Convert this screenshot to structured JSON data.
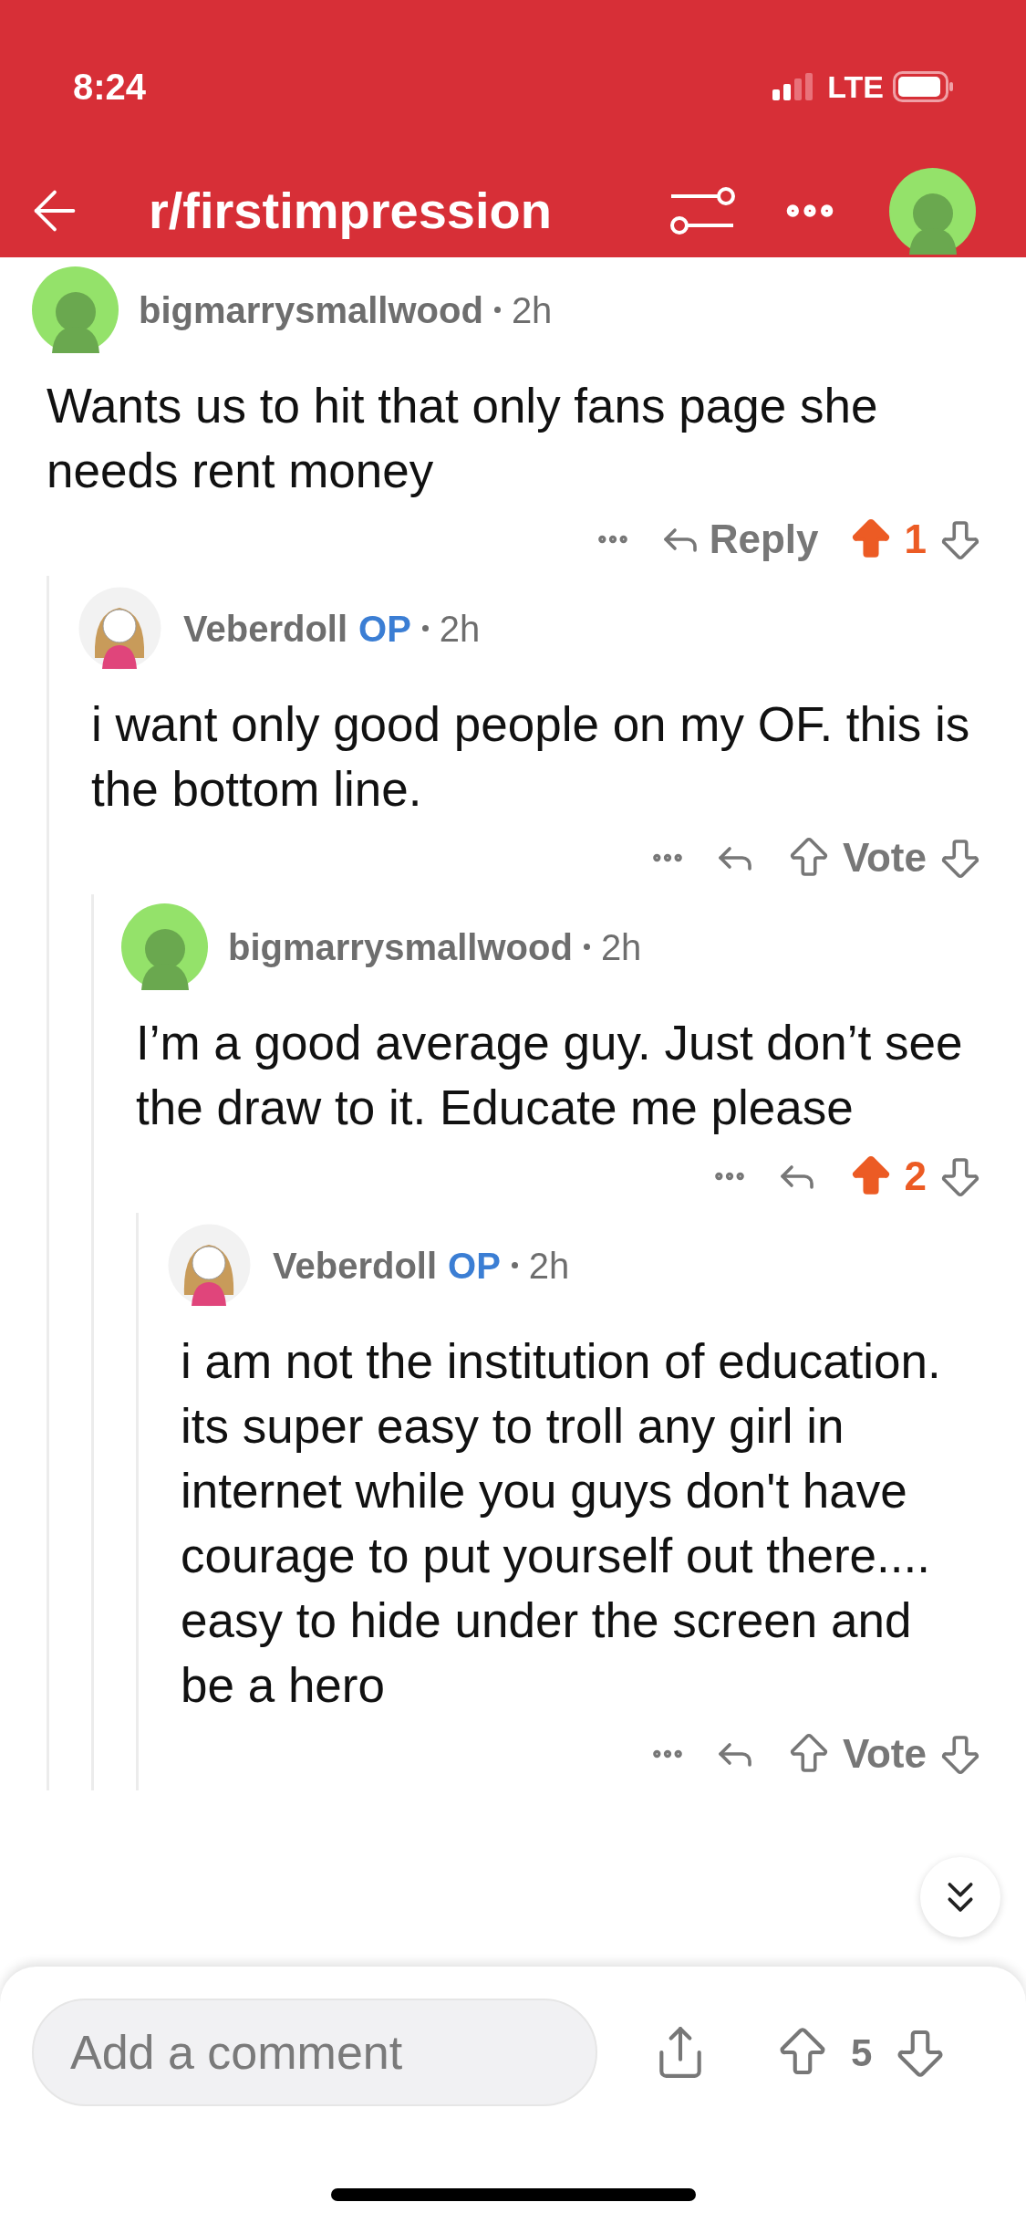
{
  "status_bar": {
    "time": "8:24",
    "network": "LTE"
  },
  "header": {
    "title": "r/firstimpression"
  },
  "comments": [
    {
      "author": "bigmarrysmallwood",
      "avatar": {
        "kind": "default"
      },
      "time": "2h",
      "body": "Wants us to hit that only fans page she needs rent money",
      "reply_label": "Reply",
      "vote": {
        "upvoted": true,
        "label": "1"
      },
      "children": [
        {
          "author": "Veberdoll",
          "badge": "OP",
          "avatar": {
            "kind": "custom"
          },
          "time": "2h",
          "body": "i want only good people on my OF. this is the bottom line.",
          "vote": {
            "upvoted": false,
            "label": "Vote"
          },
          "children": [
            {
              "author": "bigmarrysmallwood",
              "avatar": {
                "kind": "default"
              },
              "time": "2h",
              "body": "I’m a good average guy. Just don’t see the draw to it.  Educate me please",
              "vote": {
                "upvoted": true,
                "label": "2"
              },
              "children": [
                {
                  "author": "Veberdoll",
                  "badge": "OP",
                  "avatar": {
                    "kind": "custom"
                  },
                  "time": "2h",
                  "body": "i am not the institution of education. its super easy to troll any girl in internet while you guys don't have courage to put yourself out there.... easy to hide under the screen and be a hero",
                  "vote": {
                    "upvoted": false,
                    "label": "Vote"
                  }
                }
              ]
            }
          ]
        }
      ]
    }
  ],
  "footer": {
    "placeholder": "Add a comment",
    "score": "5"
  }
}
